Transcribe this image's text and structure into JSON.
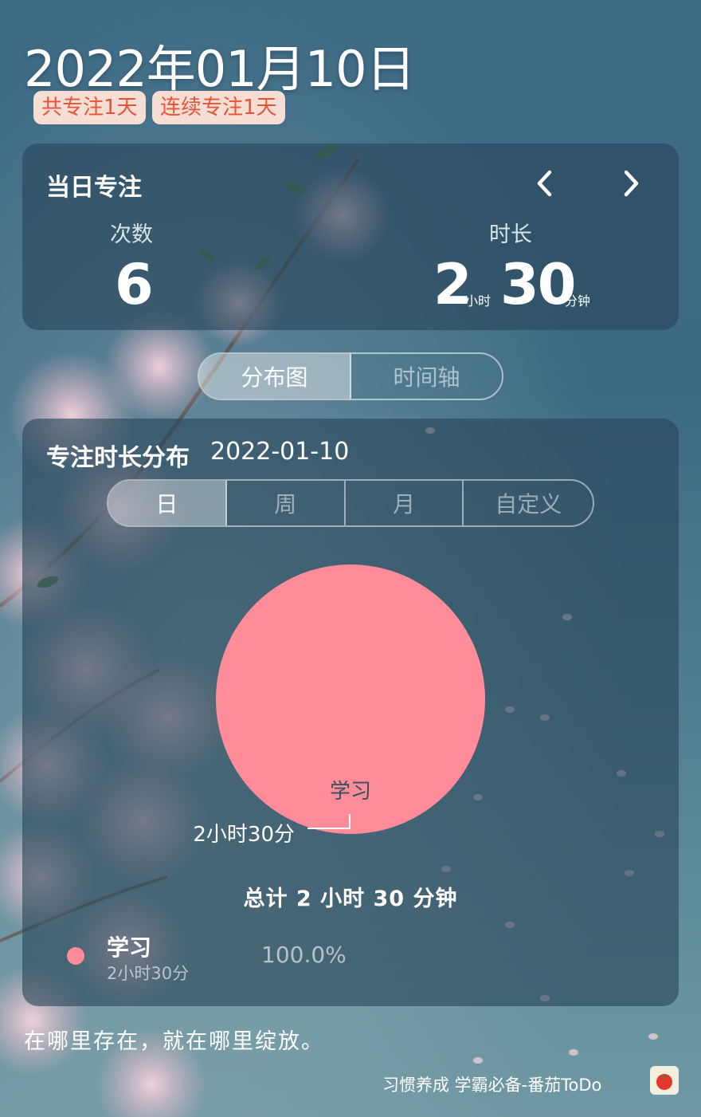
{
  "header": {
    "date": "2022年01月10日",
    "badge_total": "共专注1天",
    "badge_streak": "连续专注1天"
  },
  "daily": {
    "title": "当日专注",
    "count_label": "次数",
    "count_value": "6",
    "duration_label": "时长",
    "hours": "2",
    "hours_unit": "小时",
    "minutes": "30",
    "minutes_unit": "分钟"
  },
  "view_tabs": [
    "分布图",
    "时间轴"
  ],
  "distribution": {
    "title": "专注时长分布",
    "date": "2022-01-10",
    "range_tabs": [
      "日",
      "周",
      "月",
      "自定义"
    ],
    "slice_label": "学习",
    "slice_value_label": "2小时30分",
    "total": "总计 2 小时 30 分钟",
    "legend": [
      {
        "name": "学习",
        "time": "2小时30分",
        "percent": "100.0%",
        "color": "#ff8c98"
      }
    ]
  },
  "chart_data": {
    "type": "pie",
    "categories": [
      "学习"
    ],
    "values": [
      150
    ],
    "colors": [
      "#ff8c98"
    ]
  },
  "footer": {
    "quote": "在哪里存在，就在哪里绽放。",
    "tagline": "习惯养成 学霸必备-番茄ToDo",
    "app_icon": "tomato-icon"
  },
  "colors": {
    "badge_text": "#e4543a",
    "badge_bg": "#f7ded5",
    "slice": "#ff8c98"
  }
}
